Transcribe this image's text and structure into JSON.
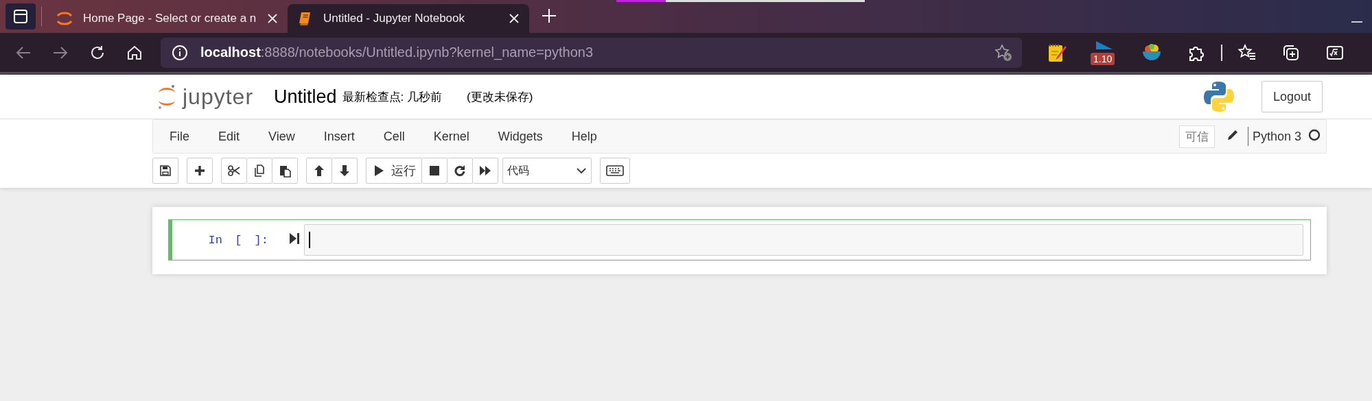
{
  "browser": {
    "tabs": [
      {
        "title": "Home Page - Select or create a n",
        "selected": false
      },
      {
        "title": "Untitled - Jupyter Notebook",
        "selected": true
      }
    ],
    "url_host": "localhost",
    "url_path": ":8888/notebooks/Untitled.ipynb?kernel_name=python3",
    "extension_badge": "1.10"
  },
  "notebook": {
    "logo_text": "jupyter",
    "name": "Untitled",
    "checkpoint": "最新检查点: 几秒前",
    "save_status": "(更改未保存)",
    "logout": "Logout",
    "menu": [
      "File",
      "Edit",
      "View",
      "Insert",
      "Cell",
      "Kernel",
      "Widgets",
      "Help"
    ],
    "trusted": "可信",
    "kernel": "Python 3",
    "kernel_busy": false,
    "run_label": "运行",
    "cell_type": "代码",
    "cell": {
      "prompt": "In [ ]:",
      "selected": true
    }
  }
}
